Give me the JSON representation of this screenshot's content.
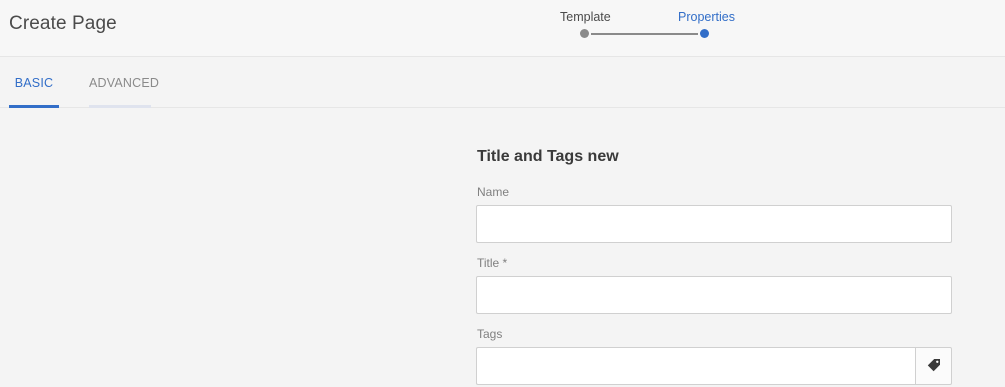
{
  "header": {
    "title": "Create Page",
    "wizard": {
      "steps": [
        {
          "label": "Template",
          "state": "completed"
        },
        {
          "label": "Properties",
          "state": "active"
        }
      ]
    }
  },
  "tabs": [
    {
      "label": "BASIC",
      "active": true
    },
    {
      "label": "ADVANCED",
      "active": false
    }
  ],
  "form": {
    "section_title": "Title and Tags new",
    "name": {
      "label": "Name",
      "value": "",
      "placeholder": ""
    },
    "title": {
      "label": "Title *",
      "value": "",
      "placeholder": ""
    },
    "tags": {
      "label": "Tags",
      "value": "",
      "placeholder": "",
      "button_icon": "tag-icon"
    }
  },
  "colors": {
    "accent": "#326ec8",
    "text": "#4b4b4b",
    "muted": "#8a8a8a",
    "background": "#f4f4f4"
  }
}
